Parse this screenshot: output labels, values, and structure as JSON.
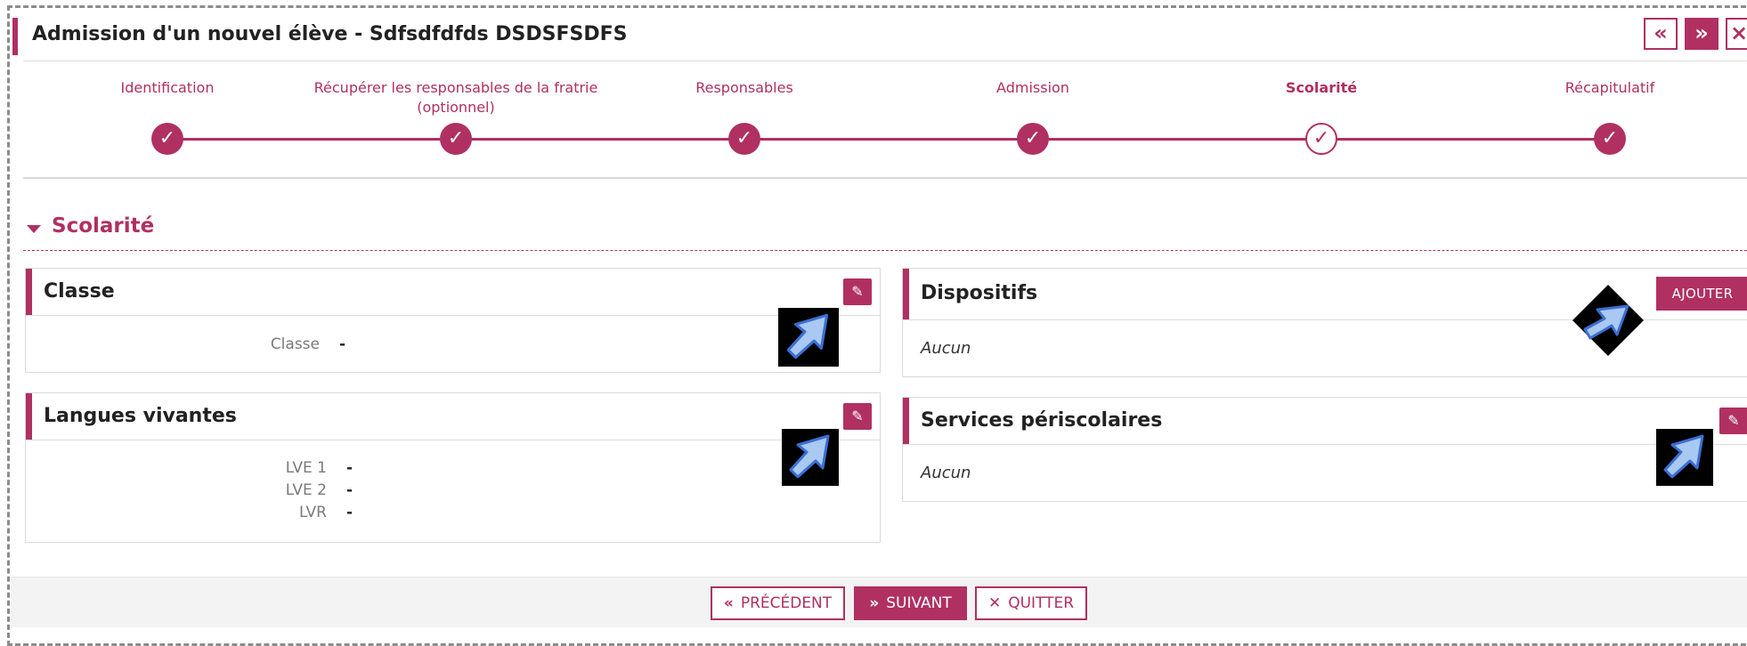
{
  "header": {
    "title": "Admission d'un nouvel élève - Sdfsdfdfds DSDSFSDFS",
    "prev_icon": "«",
    "next_icon": "»",
    "close_icon": "×"
  },
  "stepper": {
    "steps": [
      {
        "label": "Identification",
        "state": "done"
      },
      {
        "label": "Récupérer les responsables de la fratrie (optionnel)",
        "state": "done"
      },
      {
        "label": "Responsables",
        "state": "done"
      },
      {
        "label": "Admission",
        "state": "done"
      },
      {
        "label": "Scolarité",
        "state": "current"
      },
      {
        "label": "Récapitulatif",
        "state": "done"
      }
    ],
    "check_glyph": "✓"
  },
  "section": {
    "title": "Scolarité"
  },
  "cards": {
    "classe": {
      "title": "Classe",
      "fields": [
        {
          "label": "Classe",
          "value": "-"
        }
      ]
    },
    "langues": {
      "title": "Langues vivantes",
      "fields": [
        {
          "label": "LVE 1",
          "value": "-"
        },
        {
          "label": "LVE 2",
          "value": "-"
        },
        {
          "label": "LVR",
          "value": "-"
        }
      ]
    },
    "dispositifs": {
      "title": "Dispositifs",
      "empty": "Aucun",
      "add_label": "AJOUTER"
    },
    "periscolaires": {
      "title": "Services périscolaires",
      "empty": "Aucun"
    }
  },
  "footer": {
    "prev_label": "PRÉCÉDENT",
    "next_label": "SUIVANT",
    "quit_label": "QUITTER",
    "prev_icon": "«",
    "next_icon": "»",
    "quit_icon": "✕"
  },
  "colors": {
    "accent": "#b03062",
    "cursor_fill": "#a9c8f2",
    "cursor_stroke": "#3b6fd1"
  }
}
